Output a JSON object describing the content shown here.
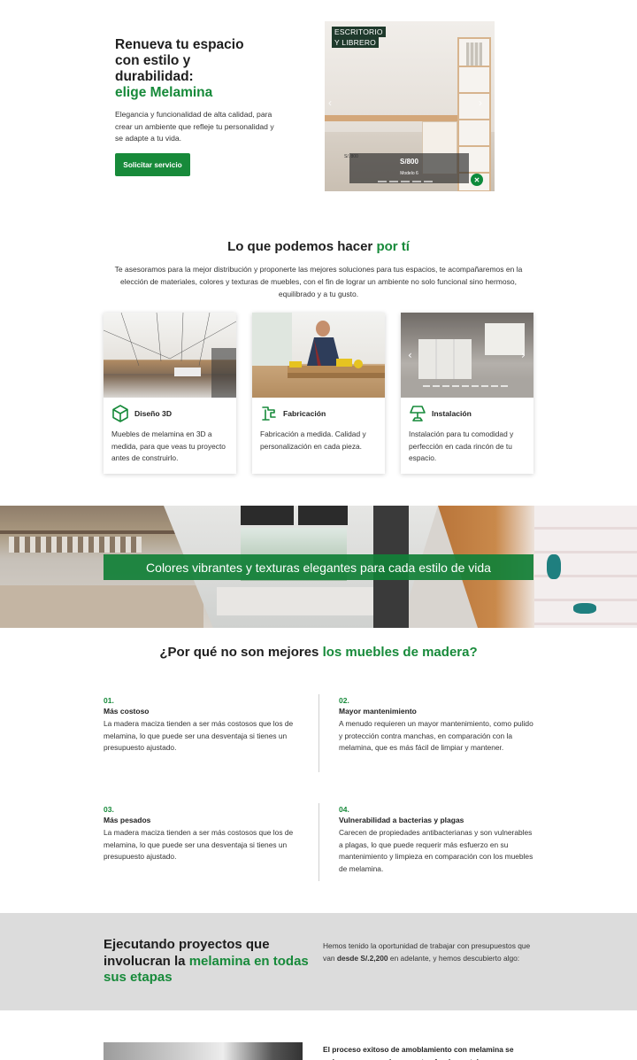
{
  "hero": {
    "title_line1": "Renueva tu espacio",
    "title_line2": "con estilo y",
    "title_line3": "durabilidad:",
    "title_highlight": "elige Melamina",
    "description": "Elegancia y funcionalidad de alta calidad, para crear un ambiente que refleje tu personalidad y se adapte a tu vida.",
    "cta_label": "Solicitar servicio"
  },
  "product": {
    "tag_line1": "ESCRITORIO",
    "tag_line2": "Y LIBRERO",
    "price": "S/800",
    "model": "Modelo 6",
    "price_small": "S/. 800"
  },
  "services": {
    "title_part1": "Lo que podemos hacer ",
    "title_highlight": "por tí",
    "description": "Te asesoramos para la mejor distribución y proponerte las mejores soluciones para tus espacios, te acompañaremos en la elección de materiales, colores y texturas de muebles, con el fin de lograr un ambiente no solo funcional sino hermoso, equilibrado y a tu gusto.",
    "cards": [
      {
        "title": "Diseño 3D",
        "text": "Muebles de melamina en 3D a medida, para que veas tu proyecto antes de construirlo.",
        "icon": "cube-icon"
      },
      {
        "title": "Fabricación",
        "text": "Fabricación a medida. Calidad y personalización en cada pieza.",
        "icon": "saw-icon"
      },
      {
        "title": "Instalación",
        "text": "Instalación para tu comodidad y perfección en cada rincón de tu espacio.",
        "icon": "lamp-icon"
      }
    ]
  },
  "banner": {
    "text": "Colores vibrantes y texturas elegantes para cada estilo de vida"
  },
  "why": {
    "title_part1": "¿Por qué no son mejores ",
    "title_highlight": "los muebles de madera?",
    "items": [
      {
        "num": "01.",
        "title": "Más costoso",
        "text": "La madera maciza tienden a ser más costosos que los de melamina, lo que puede ser una desventaja si tienes un presupuesto ajustado."
      },
      {
        "num": "02.",
        "title": "Mayor mantenimiento",
        "text": "A menudo requieren un mayor mantenimiento, como pulido y protección contra manchas, en comparación con la melamina, que es más fácil de limpiar y mantener."
      },
      {
        "num": "03.",
        "title": "Más pesados",
        "text": "La madera maciza tienden a ser más costosos que los de melamina, lo que puede ser una desventaja si tienes un presupuesto ajustado."
      },
      {
        "num": "04.",
        "title": "Vulnerabilidad a bacterias y plagas",
        "text": "Carecen de propiedades antibacterianas y son vulnerables a plagas, lo que puede requerir más esfuerzo en su mantenimiento y limpieza en comparación con los muebles de melamina."
      }
    ]
  },
  "projects": {
    "title_part1": "Ejecutando proyectos que involucran la ",
    "title_highlight": "melamina en todas sus etapas",
    "text_part1": "Hemos tenido la oportunidad de trabajar con presupuestos que van ",
    "text_bold": "desde S/.2,200",
    "text_part2": " en adelante, y hemos descubierto algo:"
  },
  "bottom": {
    "text": "El proceso exitoso de amoblamiento con melamina se reduce a comprender aspectos fundamentales:"
  },
  "colors": {
    "brand_green": "#178a3a"
  }
}
